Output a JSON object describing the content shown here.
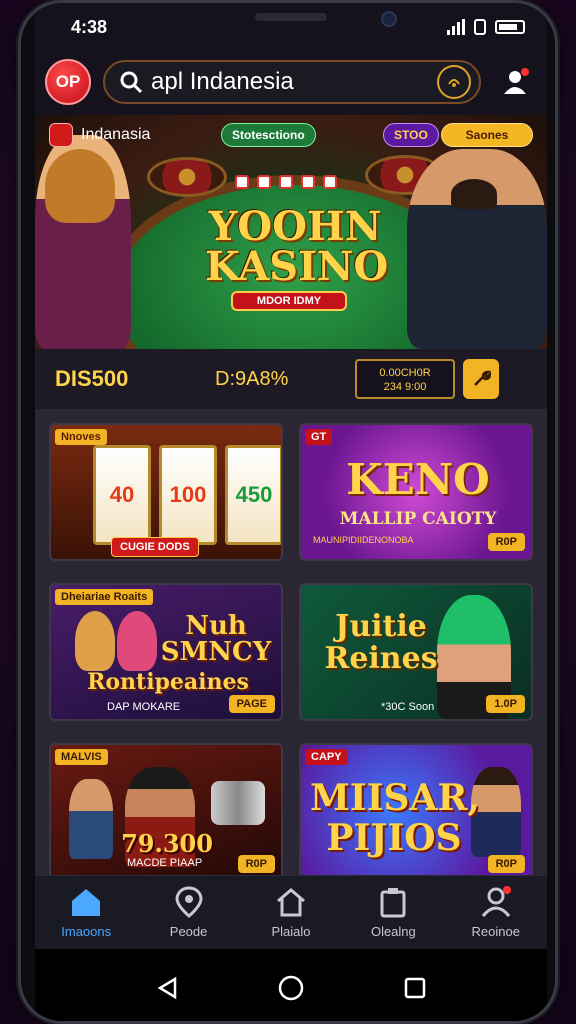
{
  "status": {
    "time": "4:38"
  },
  "appbar": {
    "logo_text": "OP",
    "search_value": "apl Indanesia"
  },
  "hero": {
    "brand": "Indanasia",
    "pill_green": "Stotesctiono",
    "pill_purple": "STOO",
    "pill_gold": "Saones",
    "title_line1": "YOOHN",
    "title_line2": "KASINO",
    "cta": "MDOR IDMY"
  },
  "balance": {
    "left": "DIS500",
    "middle": "D:9A8%",
    "box_line1": "0.00CH0R",
    "box_line2": "234 9:00",
    "action_icon": "wrench-icon"
  },
  "games": [
    {
      "tag": "Nnoves",
      "reels": [
        "40",
        "100",
        "450"
      ],
      "badge": "CUGIE DODS"
    },
    {
      "tag": "GT",
      "title": "KENO",
      "subtitle": "MALLIP CAIOTY",
      "caption": "MAUNIPIDIIDENONOBA",
      "badge": "R0P"
    },
    {
      "tag": "Dheiariae Roaits",
      "title_line1": "Nuh",
      "title_line2": "SMNCY",
      "title_line3": "Rontipeaines",
      "caption": "DAP MOKARE",
      "badge": "PAGE"
    },
    {
      "title_line1": "Juitie",
      "title_line2": "Reines",
      "caption": "*30C Soon",
      "badge": "1.0P"
    },
    {
      "tag": "MALVIS",
      "title": "79.300",
      "caption": "MACDE PIAAP",
      "badge": "R0P"
    },
    {
      "tag": "CAPY",
      "title_line1": "MIISAR,",
      "title_line2": "PIJIOS",
      "badge": "R0P"
    }
  ],
  "bottom_nav": [
    {
      "label": "Imaoons",
      "icon": "home-icon"
    },
    {
      "label": "Peode",
      "icon": "location-pin-icon"
    },
    {
      "label": "Plaialo",
      "icon": "house-outline-icon"
    },
    {
      "label": "Olealng",
      "icon": "clipboard-icon"
    },
    {
      "label": "Reoinoe",
      "icon": "user-icon"
    }
  ],
  "colors": {
    "accent": "#f2b324",
    "nav_active": "#4aa8ff",
    "brand_red": "#c10d1a"
  }
}
